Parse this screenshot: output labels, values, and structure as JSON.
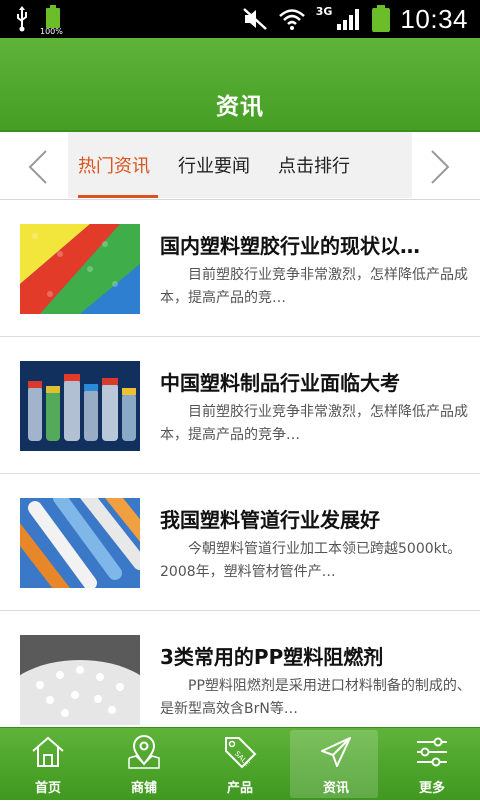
{
  "status": {
    "battery_small_pct": "100%",
    "network": "3G",
    "time": "10:34"
  },
  "header": {
    "title": "资讯"
  },
  "tabs": {
    "items": [
      "热门资讯",
      "行业要闻",
      "点击排行"
    ],
    "active": 0
  },
  "articles": [
    {
      "title": "国内塑料塑胶行业的现状以…",
      "summary": "目前塑胶行业竞争非常激烈，怎样降低产品成本，提高产品的竞…"
    },
    {
      "title": "中国塑料制品行业面临大考",
      "summary": "目前塑胶行业竞争非常激烈，怎样降低产品成本，提高产品的竞争…"
    },
    {
      "title": "我国塑料管道行业发展好",
      "summary": "今朝塑料管道行业加工本领已跨越5000kt。2008年，塑料管材管件产…"
    },
    {
      "title": "3类常用的PP塑料阻燃剂",
      "summary": "PP塑料阻燃剂是采用进口材料制备的制成的、是新型高效含BrN等…"
    }
  ],
  "nav": {
    "items": [
      {
        "label": "首页",
        "icon": "home-icon"
      },
      {
        "label": "商铺",
        "icon": "map-pin-icon"
      },
      {
        "label": "产品",
        "icon": "sale-tag-icon"
      },
      {
        "label": "资讯",
        "icon": "paper-plane-icon"
      },
      {
        "label": "更多",
        "icon": "sliders-icon"
      }
    ],
    "active": 3
  },
  "colors": {
    "brand_green": "#4ea82b",
    "accent_orange": "#d9531e"
  }
}
